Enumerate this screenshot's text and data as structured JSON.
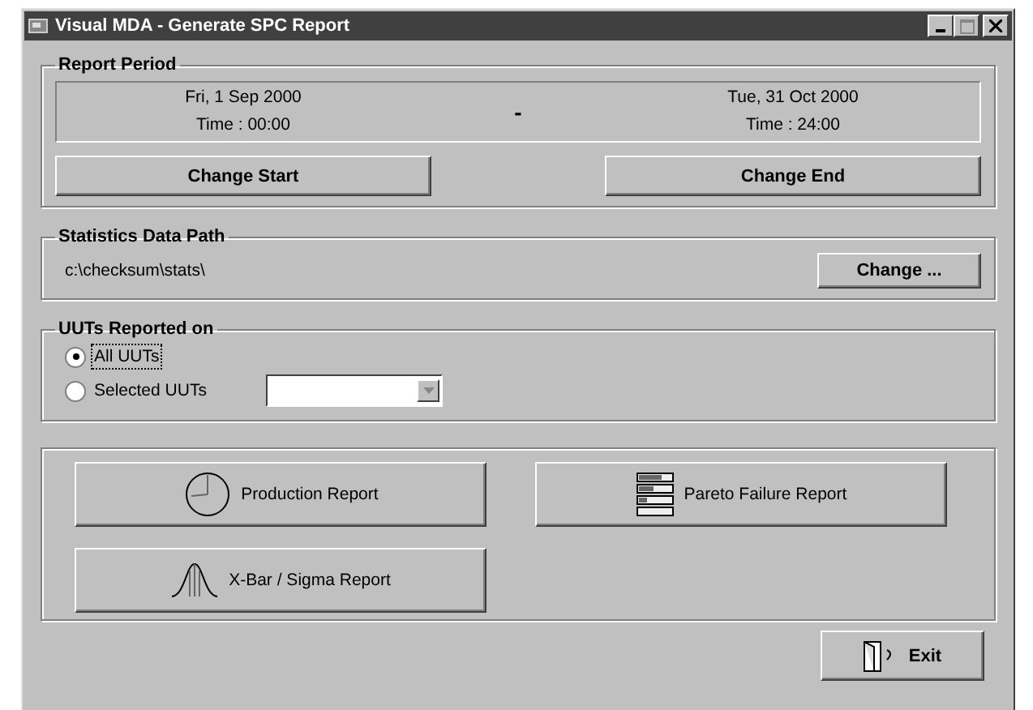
{
  "window": {
    "title": "Visual MDA - Generate SPC Report"
  },
  "report_period": {
    "title": "Report Period",
    "start_date": "Fri, 1 Sep 2000",
    "start_time": "Time : 00:00",
    "separator": "-",
    "end_date": "Tue, 31 Oct 2000",
    "end_time": "Time : 24:00",
    "buttons": [
      "Change Start",
      "Change End"
    ]
  },
  "statistics_data_path": {
    "title": "Statistics Data Path",
    "path": "c:\\checksum\\stats\\",
    "button": "Change ..."
  },
  "uuts_reported_on": {
    "title": "UUTs Reported on",
    "options": [
      {
        "label": "All UUTs",
        "selected": true
      },
      {
        "label": "Selected UUTs",
        "selected": false
      }
    ]
  },
  "report_buttons": [
    "Production Report",
    "Pareto Failure Report",
    "X-Bar / Sigma Report"
  ],
  "exit_button": "Exit"
}
